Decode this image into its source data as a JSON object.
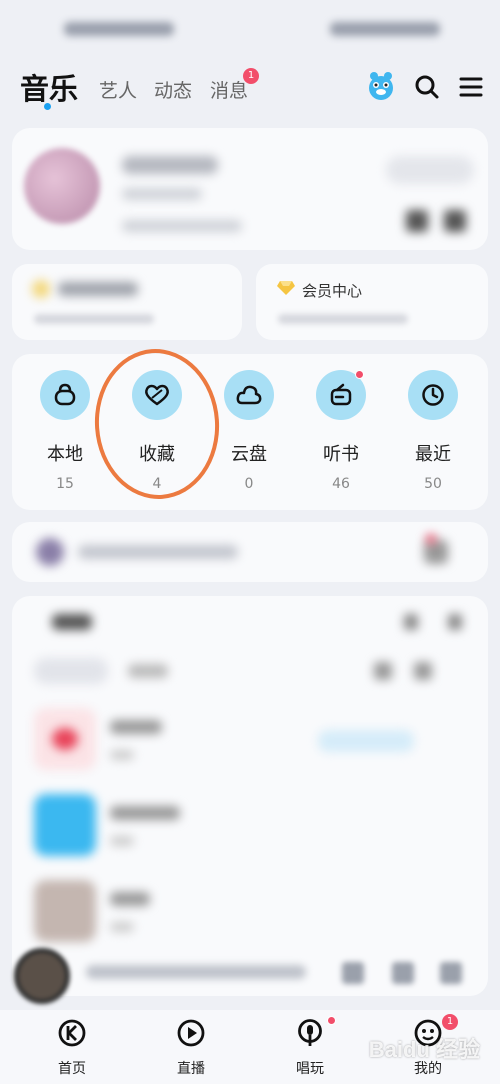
{
  "top_nav": {
    "tabs": [
      {
        "label": "音乐",
        "active": true
      },
      {
        "label": "艺人"
      },
      {
        "label": "动态"
      },
      {
        "label": "消息",
        "badge": "1"
      }
    ]
  },
  "cards": {
    "vip_title": "会员中心"
  },
  "quick_access": [
    {
      "label": "本地",
      "count": "15",
      "icon": "bag-icon"
    },
    {
      "label": "收藏",
      "count": "4",
      "icon": "heart-icon"
    },
    {
      "label": "云盘",
      "count": "0",
      "icon": "cloud-icon"
    },
    {
      "label": "听书",
      "count": "46",
      "icon": "radio-icon"
    },
    {
      "label": "最近",
      "count": "50",
      "icon": "clock-icon"
    }
  ],
  "bottom_nav": [
    {
      "label": "首页",
      "icon": "k-logo-icon"
    },
    {
      "label": "直播",
      "icon": "play-circle-icon"
    },
    {
      "label": "唱玩",
      "icon": "mic-icon"
    },
    {
      "label": "我的",
      "icon": "mascot-icon",
      "badge": "1"
    }
  ],
  "watermark": "Baidu 经验",
  "colors": {
    "accent": "#1aa1f2",
    "icon_circle": "#a8dff5",
    "badge": "#f24e6a",
    "annotation": "#ec7a40"
  }
}
